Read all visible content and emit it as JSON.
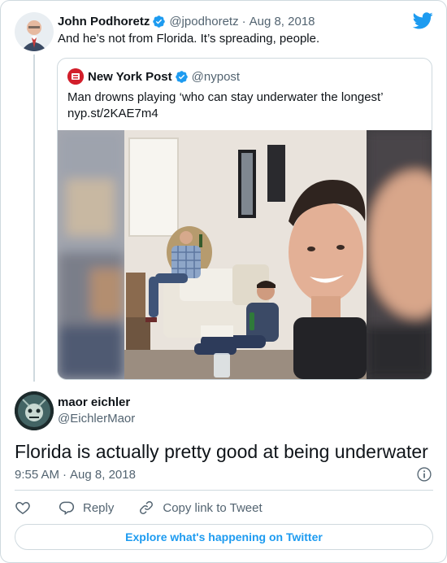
{
  "parent_tweet": {
    "author_name": "John Podhoretz",
    "author_handle": "@jpodhoretz",
    "date": "Aug 8, 2018",
    "text": "And he’s not from Florida. It’s spreading, people.",
    "verified": true
  },
  "quoted_tweet": {
    "author_name": "New York Post",
    "author_handle": "@nypost",
    "verified": true,
    "text_line1": "Man drowns playing ‘who can stay underwater the longest’",
    "text_line2": "nyp.st/2KAE7m4"
  },
  "main_tweet": {
    "author_name": "maor eichler",
    "author_handle": "@EichlerMaor",
    "text": "Florida is actually pretty good at being underwater",
    "time": "9:55 AM",
    "date": "Aug 8, 2018"
  },
  "actions": {
    "reply_label": "Reply",
    "copy_label": "Copy link to Tweet"
  },
  "footer": {
    "explore_label": "Explore what's happening on Twitter"
  },
  "colors": {
    "accent": "#1d9bf0",
    "text": "#0f1419",
    "muted": "#536471",
    "border": "#cfd9de"
  }
}
